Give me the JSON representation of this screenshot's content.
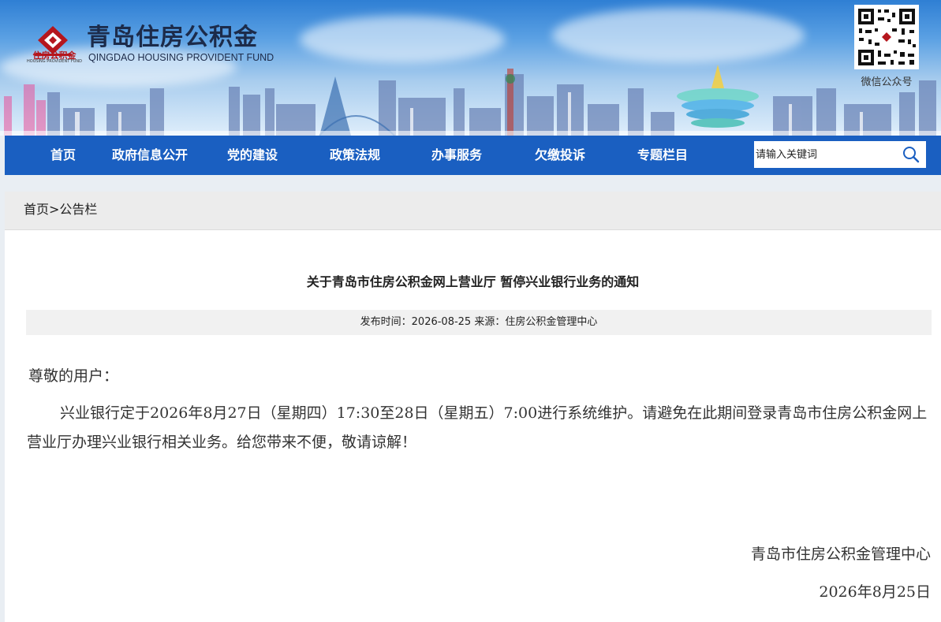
{
  "header": {
    "site_title_cn": "青岛住房公积金",
    "site_title_en": "QINGDAO HOUSING PROVIDENT FUND",
    "logo_text": "住房公积金",
    "logo_text_en": "HOUSING PROVIDENT FUND",
    "qr_label": "微信公众号"
  },
  "nav": {
    "items": [
      {
        "label": "首页"
      },
      {
        "label": "政府信息公开"
      },
      {
        "label": "党的建设"
      },
      {
        "label": "政策法规"
      },
      {
        "label": "办事服务"
      },
      {
        "label": "欠缴投诉"
      },
      {
        "label": "专题栏目"
      }
    ],
    "search_placeholder": "请输入关键词"
  },
  "breadcrumb": {
    "home": "首页",
    "separator": ">",
    "current": "公告栏"
  },
  "article": {
    "title": "关于青岛市住房公积金网上营业厅 暂停兴业银行业务的通知",
    "meta": "发布时间：2026-08-25 来源：住房公积金管理中心",
    "greeting": "尊敬的用户：",
    "paragraph": "兴业银行定于2026年8月27日（星期四）17:30至28日（星期五）7:00进行系统维护。请避免在此期间登录青岛市住房公积金网上营业厅办理兴业银行相关业务。给您带来不便，敬请谅解！",
    "signature_org": "青岛市住房公积金管理中心",
    "signature_date": "2026年8月25日"
  },
  "colors": {
    "nav_bg": "#1a5fc1",
    "logo_red": "#b5161d",
    "title_dark": "#1c2b4a"
  }
}
